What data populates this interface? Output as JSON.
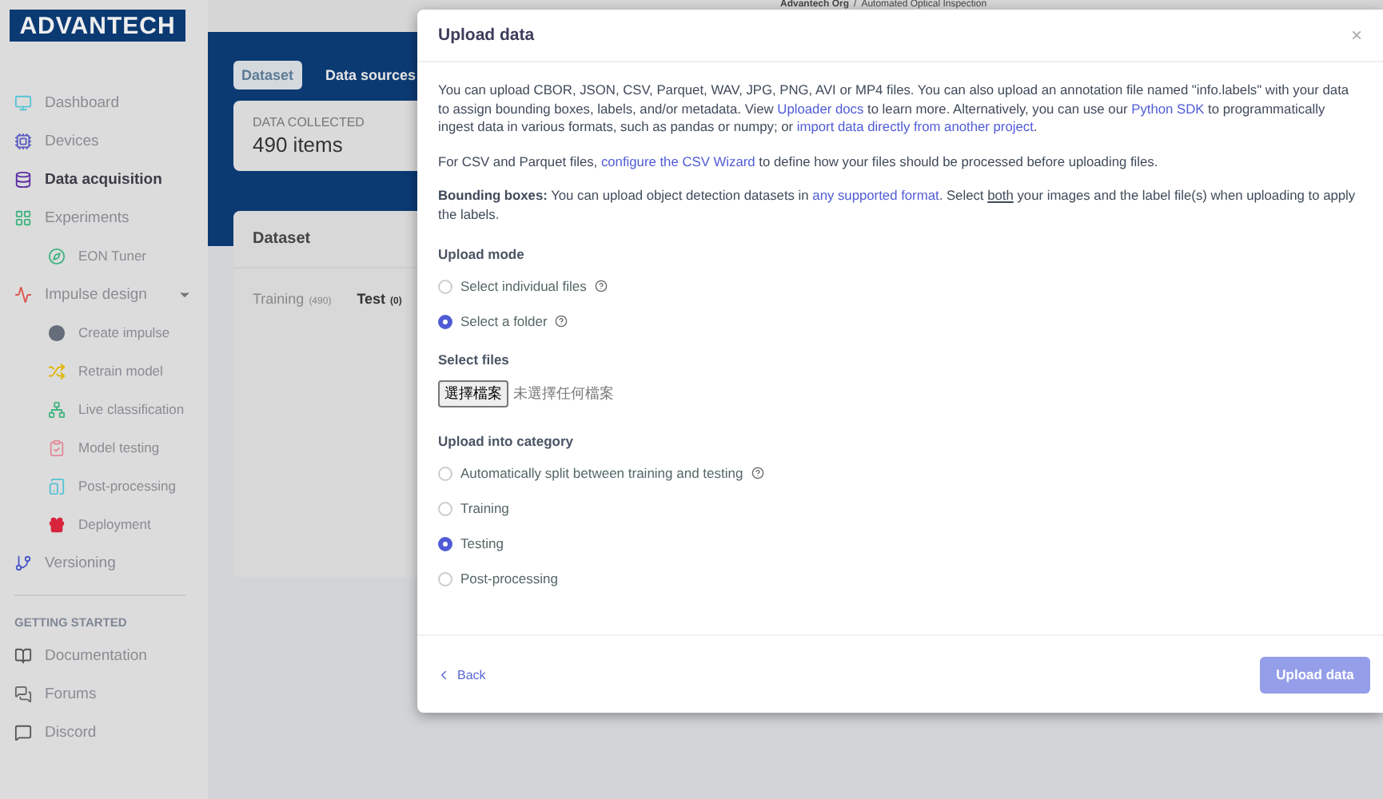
{
  "logo": "ADVANTECH",
  "header": {
    "org": "Advantech Org",
    "separator": "/",
    "project": "Automated Optical Inspection"
  },
  "sidebar": {
    "items": [
      {
        "label": "Dashboard",
        "selected": false
      },
      {
        "label": "Devices",
        "selected": false
      },
      {
        "label": "Data acquisition",
        "selected": true
      },
      {
        "label": "Experiments",
        "selected": false,
        "children": [
          {
            "label": "EON Tuner",
            "selected": false
          }
        ]
      },
      {
        "label": "Impulse design",
        "selected": false,
        "expanded": true,
        "children": [
          {
            "label": "Create impulse",
            "selected": false
          },
          {
            "label": "Retrain model",
            "selected": false
          },
          {
            "label": "Live classification",
            "selected": false
          },
          {
            "label": "Model testing",
            "selected": false
          },
          {
            "label": "Post-processing",
            "selected": false
          },
          {
            "label": "Deployment",
            "selected": false
          }
        ]
      },
      {
        "label": "Versioning",
        "selected": false
      }
    ],
    "section_title": "GETTING STARTED",
    "links": [
      {
        "label": "Documentation"
      },
      {
        "label": "Forums"
      },
      {
        "label": "Discord"
      }
    ]
  },
  "main": {
    "tabs": [
      {
        "label": "Dataset",
        "selected": true
      },
      {
        "label": "Data sources",
        "selected": false
      }
    ],
    "summary": {
      "label": "DATA COLLECTED",
      "value": "490 items"
    },
    "dataset": {
      "title": "Dataset",
      "tabs": [
        {
          "label": "Training",
          "count": "(490)",
          "selected": false
        },
        {
          "label": "Test",
          "count": "(0)",
          "selected": true
        }
      ]
    }
  },
  "modal": {
    "title": "Upload data",
    "close": "×",
    "paragraphs": [
      [
        {
          "kind": "text",
          "text": "You can upload CBOR, JSON, CSV, Parquet, WAV, JPG, PNG, AVI or MP4 files. You can also upload an annotation file named \"info.labels\" with your data to assign bounding boxes, labels, and/or metadata. View "
        },
        {
          "kind": "link",
          "text": "Uploader docs"
        },
        {
          "kind": "text",
          "text": " to learn more. Alternatively, you can use our "
        },
        {
          "kind": "link",
          "text": "Python SDK"
        },
        {
          "kind": "text",
          "text": " to programmatically ingest data in various formats, such as pandas or numpy; or "
        },
        {
          "kind": "link",
          "text": "import data directly from another project"
        },
        {
          "kind": "text",
          "text": "."
        }
      ],
      [
        {
          "kind": "text",
          "text": "For CSV and Parquet files, "
        },
        {
          "kind": "link",
          "text": "configure the CSV Wizard"
        },
        {
          "kind": "text",
          "text": " to define how your files should be processed before uploading files."
        }
      ],
      [
        {
          "kind": "text",
          "text": "**Bounding boxes:** You can upload object detection datasets in "
        },
        {
          "kind": "link",
          "text": "any supported format"
        },
        {
          "kind": "text",
          "text": ". Select "
        },
        {
          "kind": "underline",
          "text": "both"
        },
        {
          "kind": "text",
          "text": " your images and the label file(s) when uploading to apply the labels."
        }
      ]
    ],
    "upload_mode": {
      "title": "Upload mode",
      "options": [
        {
          "label": "Select individual files",
          "help": true,
          "selected": false
        },
        {
          "label": "Select a folder",
          "help": true,
          "selected": true
        }
      ]
    },
    "select_files": {
      "title": "Select files",
      "button": "選擇檔案",
      "status": "未選擇任何檔案"
    },
    "category": {
      "title": "Upload into category",
      "options": [
        {
          "label": "Automatically split between training and testing",
          "help": true,
          "selected": false
        },
        {
          "label": "Training",
          "help": false,
          "selected": false
        },
        {
          "label": "Testing",
          "help": false,
          "selected": true
        },
        {
          "label": "Post-processing",
          "help": false,
          "selected": false
        }
      ]
    },
    "back": "Back",
    "submit": "Upload data"
  }
}
